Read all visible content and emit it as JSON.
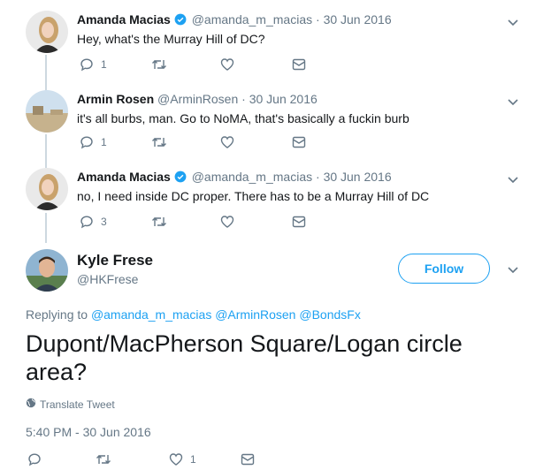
{
  "thread": [
    {
      "name": "Amanda Macias",
      "verified": true,
      "handle": "@amanda_m_macias",
      "separator": "·",
      "date": "30 Jun 2016",
      "text": "Hey, what's the Murray Hill of DC?",
      "reply_count": "1",
      "retweet_count": "",
      "like_count": ""
    },
    {
      "name": "Armin Rosen",
      "verified": false,
      "handle": "@ArminRosen",
      "separator": "·",
      "date": "30 Jun 2016",
      "text": "it's all burbs, man. Go to NoMA, that's basically a fuckin burb",
      "reply_count": "1",
      "retweet_count": "",
      "like_count": ""
    },
    {
      "name": "Amanda Macias",
      "verified": true,
      "handle": "@amanda_m_macias",
      "separator": "·",
      "date": "30 Jun 2016",
      "text": "no, I need inside DC proper. There has to be a Murray Hill of DC",
      "reply_count": "3",
      "retweet_count": "",
      "like_count": ""
    }
  ],
  "main_tweet": {
    "name": "Kyle Frese",
    "handle": "@HKFrese",
    "follow_label": "Follow",
    "replying_prefix": "Replying to",
    "mentions": [
      "@amanda_m_macias",
      "@ArminRosen",
      "@BondsFx"
    ],
    "text": "Dupont/MacPherson Square/Logan circle area?",
    "translate_label": "Translate Tweet",
    "timestamp": "5:40 PM - 30 Jun 2016",
    "reply_count": "",
    "retweet_count": "",
    "like_count": "1"
  },
  "icons": {
    "reply": "reply-icon",
    "retweet": "retweet-icon",
    "like": "heart-icon",
    "dm": "envelope-icon",
    "more": "chevron-down-icon",
    "verified": "verified-badge-icon",
    "globe": "globe-icon"
  },
  "colors": {
    "accent": "#1da1f2",
    "secondary_text": "#657786",
    "primary_text": "#14171a",
    "thread_line": "#cdd8e0"
  }
}
